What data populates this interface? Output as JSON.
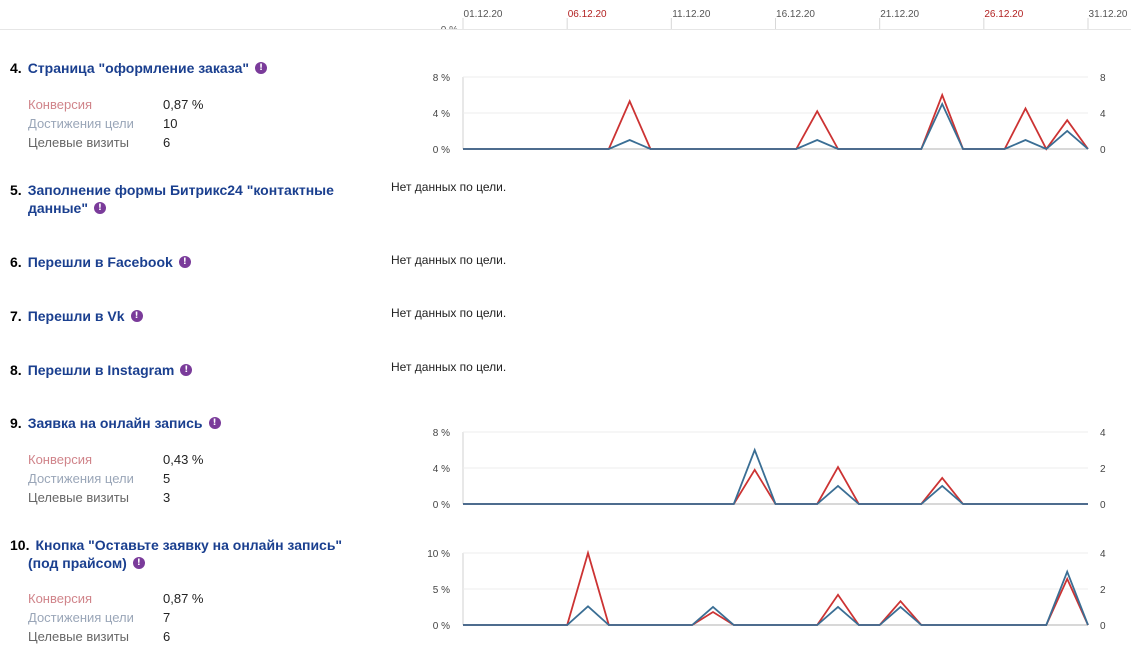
{
  "dates": {
    "labels": [
      "01.12.20",
      "06.12.20",
      "11.12.20",
      "16.12.20",
      "21.12.20",
      "26.12.20",
      "31.12.20"
    ],
    "weekend_color": "#b22222",
    "normal_color": "#555555",
    "weekend": [
      false,
      true,
      false,
      false,
      false,
      true,
      false
    ]
  },
  "colors": {
    "conversion": "#cc3333",
    "visits": "#3a6e94",
    "title": "#1a3f8f"
  },
  "goals": [
    {
      "number": "4.",
      "name": "Страница \"оформление заказа\"",
      "stats": {
        "conversion_label": "Конверсия",
        "conversion": "0,87 %",
        "achievements_label": "Достижения цели",
        "achievements": "10",
        "visits_label": "Целевые визиты",
        "visits": "6"
      }
    },
    {
      "number": "5.",
      "name_line1": "Заполнение формы Битрикс24 \"контактные",
      "name_line2": "данные\"",
      "nodata": "Нет данных по цели."
    },
    {
      "number": "6.",
      "name": "Перешли в Facebook",
      "nodata": "Нет данных по цели."
    },
    {
      "number": "7.",
      "name": "Перешли в Vk",
      "nodata": "Нет данных по цели."
    },
    {
      "number": "8.",
      "name": "Перешли в Instagram",
      "nodata": "Нет данных по цели."
    },
    {
      "number": "9.",
      "name": "Заявка на онлайн запись",
      "stats": {
        "conversion_label": "Конверсия",
        "conversion": "0,43 %",
        "achievements_label": "Достижения цели",
        "achievements": "5",
        "visits_label": "Целевые визиты",
        "visits": "3"
      }
    },
    {
      "number": "10.",
      "name_line1": "Кнопка \"Оставьте заявку на онлайн запись\"",
      "name_line2": "(под прайсом)",
      "stats": {
        "conversion_label": "Конверсия",
        "conversion": "0,87 %",
        "achievements_label": "Достижения цели",
        "achievements": "7",
        "visits_label": "Целевые визиты",
        "visits": "6"
      }
    }
  ],
  "chart_data": [
    {
      "type": "line",
      "goal": "4.",
      "x_start": 1,
      "x_end": 31,
      "ylim_left": [
        0,
        8
      ],
      "ylim_right": [
        0,
        8
      ],
      "left_ticks": [
        "0 %",
        "4 %",
        "8 %"
      ],
      "right_ticks": [
        "0",
        "4",
        "8"
      ],
      "series": [
        {
          "color": "#cc3333",
          "points": [
            [
              1,
              0
            ],
            [
              8,
              0
            ],
            [
              9,
              5.3
            ],
            [
              10,
              0
            ],
            [
              17,
              0
            ],
            [
              18,
              4.2
            ],
            [
              19,
              0
            ],
            [
              23,
              0
            ],
            [
              24,
              6
            ],
            [
              25,
              0
            ],
            [
              27,
              0
            ],
            [
              28,
              4.5
            ],
            [
              29,
              0
            ],
            [
              30,
              3.2
            ],
            [
              31,
              0
            ]
          ]
        },
        {
          "color": "#3a6e94",
          "points": [
            [
              1,
              0
            ],
            [
              8,
              0
            ],
            [
              9,
              1
            ],
            [
              10,
              0
            ],
            [
              17,
              0
            ],
            [
              18,
              1
            ],
            [
              19,
              0
            ],
            [
              23,
              0
            ],
            [
              24,
              5
            ],
            [
              25,
              0
            ],
            [
              27,
              0
            ],
            [
              28,
              1
            ],
            [
              29,
              0
            ],
            [
              30,
              2
            ],
            [
              31,
              0
            ]
          ]
        }
      ]
    },
    {
      "type": "line",
      "goal": "9.",
      "x_start": 1,
      "x_end": 31,
      "ylim_left": [
        0,
        8
      ],
      "ylim_right": [
        0,
        4
      ],
      "left_ticks": [
        "0 %",
        "4 %",
        "8 %"
      ],
      "right_ticks": [
        "0",
        "2",
        "4"
      ],
      "series": [
        {
          "color": "#cc3333",
          "points": [
            [
              1,
              0
            ],
            [
              14,
              0
            ],
            [
              15,
              3.8
            ],
            [
              16,
              0
            ],
            [
              18,
              0
            ],
            [
              19,
              4.1
            ],
            [
              20,
              0
            ],
            [
              23,
              0
            ],
            [
              24,
              2.9
            ],
            [
              25,
              0
            ],
            [
              31,
              0
            ]
          ]
        },
        {
          "color": "#3a6e94",
          "points": [
            [
              1,
              0
            ],
            [
              14,
              0
            ],
            [
              15,
              6
            ],
            [
              16,
              0
            ],
            [
              18,
              0
            ],
            [
              19,
              2
            ],
            [
              20,
              0
            ],
            [
              23,
              0
            ],
            [
              24,
              2
            ],
            [
              25,
              0
            ],
            [
              31,
              0
            ]
          ]
        }
      ]
    },
    {
      "type": "line",
      "goal": "10.",
      "x_start": 1,
      "x_end": 31,
      "ylim_left": [
        0,
        10
      ],
      "ylim_right": [
        0,
        4
      ],
      "left_ticks": [
        "0 %",
        "5 %",
        "10 %"
      ],
      "right_ticks": [
        "0",
        "2",
        "4"
      ],
      "series": [
        {
          "color": "#cc3333",
          "points": [
            [
              1,
              0
            ],
            [
              6,
              0
            ],
            [
              7,
              10
            ],
            [
              8,
              0
            ],
            [
              12,
              0
            ],
            [
              13,
              1.8
            ],
            [
              14,
              0
            ],
            [
              18,
              0
            ],
            [
              19,
              4.2
            ],
            [
              20,
              0
            ],
            [
              21,
              0
            ],
            [
              22,
              3.3
            ],
            [
              23,
              0
            ],
            [
              29,
              0
            ],
            [
              30,
              6.4
            ],
            [
              31,
              0
            ]
          ]
        },
        {
          "color": "#3a6e94",
          "points": [
            [
              1,
              0
            ],
            [
              6,
              0
            ],
            [
              7,
              2.6
            ],
            [
              8,
              0
            ],
            [
              12,
              0
            ],
            [
              13,
              2.5
            ],
            [
              14,
              0
            ],
            [
              18,
              0
            ],
            [
              19,
              2.5
            ],
            [
              20,
              0
            ],
            [
              21,
              0
            ],
            [
              22,
              2.5
            ],
            [
              23,
              0
            ],
            [
              29,
              0
            ],
            [
              30,
              7.4
            ],
            [
              31,
              0
            ]
          ]
        }
      ]
    }
  ]
}
